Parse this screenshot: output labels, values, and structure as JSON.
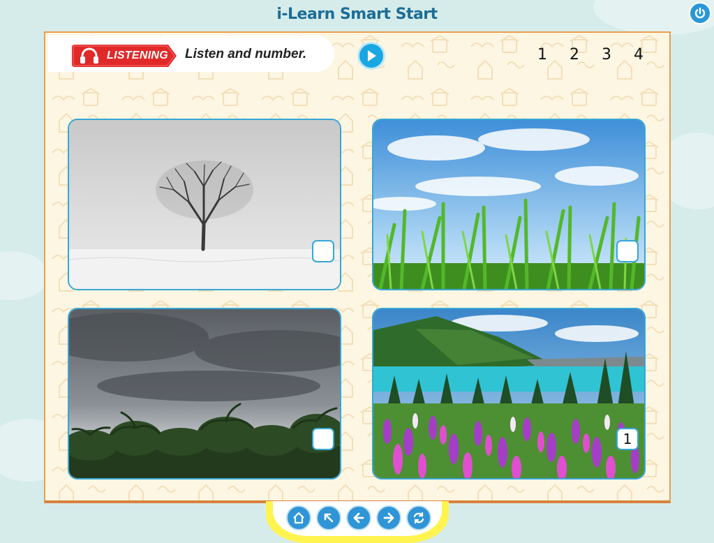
{
  "app": {
    "title": "i-Learn Smart Start"
  },
  "activity": {
    "tag_label": "LISTENING",
    "instruction": "Listen and number.",
    "number_options": [
      "1",
      "2",
      "3",
      "4"
    ]
  },
  "photos": [
    {
      "scene": "bare tree in snowy field",
      "answer": ""
    },
    {
      "scene": "green grass under blue sky",
      "answer": ""
    },
    {
      "scene": "dark storm clouds over palm trees",
      "answer": ""
    },
    {
      "scene": "lake with purple lupine flowers",
      "answer": "1"
    }
  ],
  "icons": {
    "power": "power-icon",
    "headphones": "headphones-icon",
    "play": "play-icon",
    "home": "home-icon",
    "back_to_top": "arrow-up-left-icon",
    "previous": "arrow-left-icon",
    "next": "arrow-right-icon",
    "reset": "refresh-icon"
  },
  "colors": {
    "accent_blue": "#2f95d6",
    "title_blue": "#1d6d96",
    "tag_red": "#e02a2a",
    "board_border": "#ee9d4a",
    "tray_yellow": "#fff44f"
  }
}
